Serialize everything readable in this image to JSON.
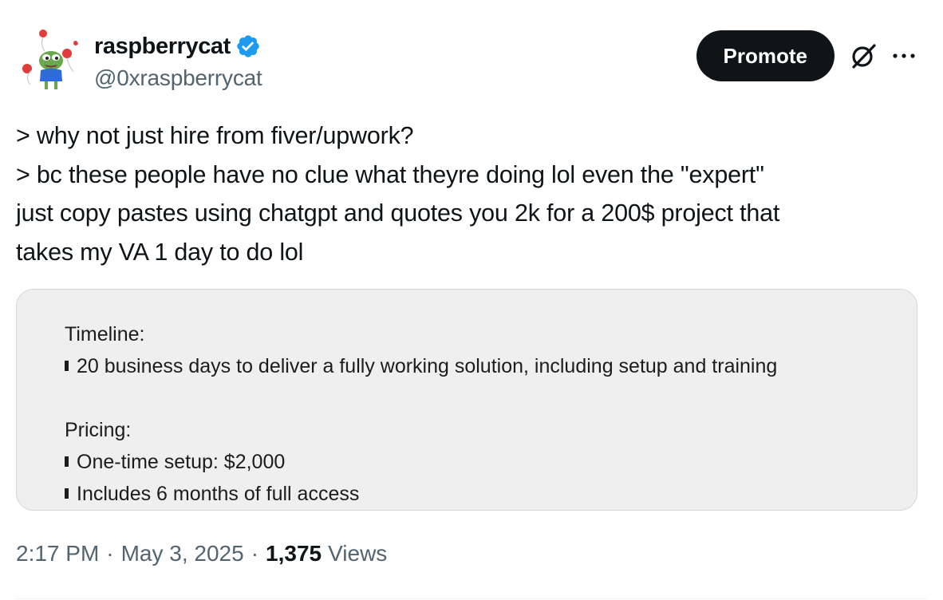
{
  "author": {
    "display_name": "raspberrycat",
    "handle": "@0xraspberrycat",
    "verified": true
  },
  "actions": {
    "promote_label": "Promote",
    "grok_icon": "slashed-circle-icon",
    "more_icon": "ellipsis-icon"
  },
  "tweet": {
    "lines": [
      "> why not just hire from fiver/upwork?",
      "> bc these people have no clue what theyre doing lol even the \"expert\"",
      "just copy pastes using chatgpt and quotes you 2k for a 200$ project that",
      "takes my VA 1 day to do lol"
    ]
  },
  "quote": {
    "timeline_heading": "Timeline:",
    "timeline_items": [
      "20 business days to deliver a fully working solution, including setup and training"
    ],
    "pricing_heading": "Pricing:",
    "pricing_items": [
      "One-time setup: $2,000",
      "Includes 6 months of full access"
    ]
  },
  "meta": {
    "time": "2:17 PM",
    "separator": "·",
    "date": "May 3, 2025",
    "views_count": "1,375",
    "views_label": "Views"
  },
  "colors": {
    "text_primary": "#0f1419",
    "text_secondary": "#536471",
    "verified_blue": "#1d9bf0",
    "promote_bg": "#0f1419",
    "quote_bg": "#efefef"
  }
}
